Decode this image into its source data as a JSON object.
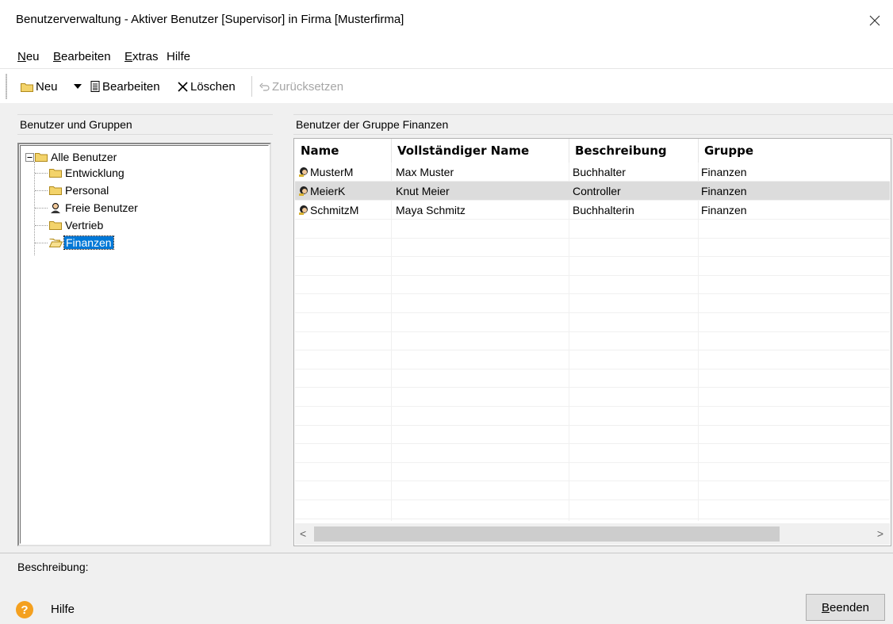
{
  "window": {
    "title": "Benutzerverwaltung - Aktiver Benutzer [Supervisor] in Firma [Musterfirma]",
    "close_glyph": "✕"
  },
  "menu": {
    "items": [
      {
        "first": "N",
        "rest": "eu"
      },
      {
        "first": "B",
        "rest": "earbeiten"
      },
      {
        "first": "E",
        "rest": "xtras"
      },
      {
        "first": "",
        "rest": "Hilfe"
      }
    ]
  },
  "toolbar": {
    "new_label": "Neu",
    "edit_label": "Bearbeiten",
    "delete_label": "Löschen",
    "reset_label": "Zurücksetzen"
  },
  "left_panel": {
    "header": "Benutzer und Gruppen",
    "root_label": "Alle Benutzer",
    "nodes": [
      {
        "label": "Entwicklung",
        "icon": "folder-icon"
      },
      {
        "label": "Personal",
        "icon": "folder-icon"
      },
      {
        "label": "Freie Benutzer",
        "icon": "user-icon"
      },
      {
        "label": "Vertrieb",
        "icon": "folder-icon"
      },
      {
        "label": "Finanzen",
        "icon": "folder-open-icon",
        "selected": true
      }
    ]
  },
  "right_panel": {
    "header": "Benutzer der Gruppe Finanzen",
    "columns": [
      "Name",
      "Vollständiger Name",
      "Beschreibung",
      "Gruppe"
    ],
    "rows": [
      [
        "MusterM",
        "Max Muster",
        "Buchhalter",
        "Finanzen"
      ],
      [
        "MeierK",
        "Knut Meier",
        "Controller",
        "Finanzen"
      ],
      [
        "SchmitzM",
        "Maya Schmitz",
        "Buchhalterin",
        "Finanzen"
      ]
    ],
    "scroll_left": "<",
    "scroll_right": ">"
  },
  "description": {
    "label": "Beschreibung:"
  },
  "footer": {
    "help_glyph": "?",
    "help_label": "Hilfe",
    "close_first": "B",
    "close_rest": "eenden"
  },
  "colors": {
    "selection": "#0078d7",
    "help_icon": "#f4a01f",
    "folder": "#f3d36a"
  }
}
